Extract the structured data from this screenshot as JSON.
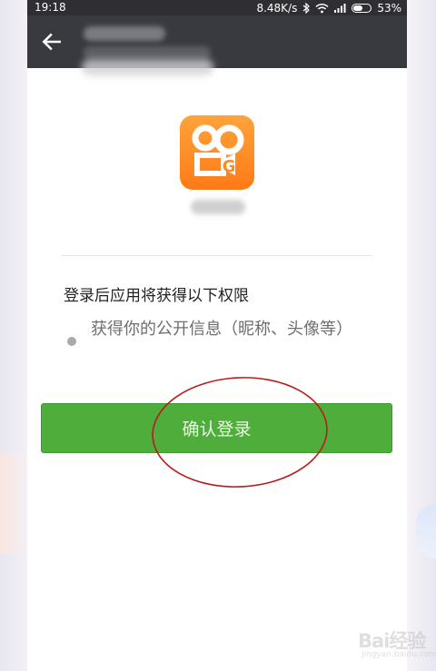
{
  "status_bar": {
    "time": "19:18",
    "network_speed": "8.48K/s",
    "battery_percent": "53%",
    "battery_level": 0.53,
    "icons": [
      "bluetooth-icon",
      "wifi-icon",
      "signal-icon",
      "battery-icon"
    ]
  },
  "header": {
    "back_icon": "arrow-left-icon"
  },
  "app": {
    "icon": "kuaishou-app-icon"
  },
  "permissions": {
    "title": "登录后应用将获得以下权限",
    "items": [
      "获得你的公开信息（昵称、头像等）"
    ]
  },
  "login_button": {
    "label": "确认登录"
  },
  "watermark": {
    "text": "Bai经验",
    "url": "jingyan.baidu.com"
  },
  "colors": {
    "header_bg": "#393a3f",
    "button_green": "#4fad3b",
    "annotation_red": "#b81c1c",
    "app_orange": "#ff8a23"
  }
}
